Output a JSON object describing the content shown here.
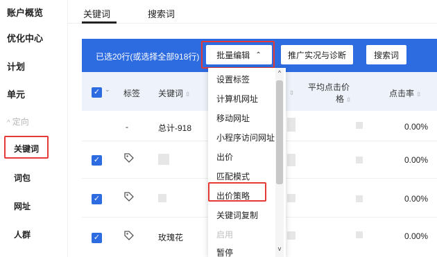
{
  "sidebar": {
    "items": [
      {
        "label": "账户概览"
      },
      {
        "label": "优化中心"
      },
      {
        "label": "计划"
      },
      {
        "label": "单元"
      },
      {
        "label": "定向"
      },
      {
        "label": "关键词"
      },
      {
        "label": "词包"
      },
      {
        "label": "网址"
      },
      {
        "label": "人群"
      }
    ]
  },
  "tabs": [
    {
      "label": "关键词"
    },
    {
      "label": "搜索词"
    }
  ],
  "toolbar": {
    "selected_text": "已选20行(或选择全部918行)",
    "batch_edit_label": "批量编辑",
    "promo_label": "推广实况与诊断",
    "search_terms_label": "搜索词"
  },
  "table": {
    "headers": {
      "tag": "标签",
      "keyword": "关键词",
      "avg_cpc_line1": "平均点击价",
      "avg_cpc_line2": "格",
      "ctr": "点击率"
    },
    "rows": [
      {
        "tag": "-",
        "keyword": "总计-918",
        "ctr": "0.00%"
      },
      {
        "keyword": "",
        "ctr": "0.00%"
      },
      {
        "keyword": "",
        "ctr": "0.00%"
      },
      {
        "keyword": "玫瑰花",
        "ctr": "0.00%"
      }
    ]
  },
  "dropdown": {
    "items": [
      {
        "label": "设置标签"
      },
      {
        "label": "计算机网址"
      },
      {
        "label": "移动网址"
      },
      {
        "label": "小程序访问网址"
      },
      {
        "label": "出价"
      },
      {
        "label": "匹配模式"
      },
      {
        "label": "出价策略"
      },
      {
        "label": "关键词复制"
      },
      {
        "label": "启用"
      },
      {
        "label": "暂停"
      }
    ]
  },
  "colors": {
    "accent": "#2d6be0",
    "highlight": "#e53935",
    "header_bg": "#eef3fb"
  }
}
